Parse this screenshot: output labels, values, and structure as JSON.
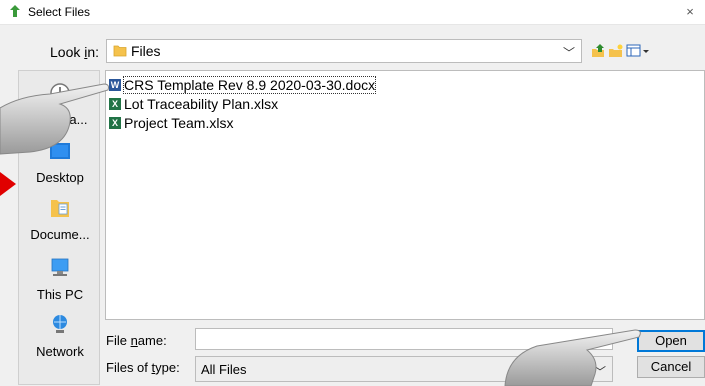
{
  "window": {
    "title": "Select Files",
    "close_glyph": "×"
  },
  "lookin": {
    "label_pre": "Look ",
    "label_u": "i",
    "label_post": "n:",
    "value": "Files"
  },
  "toolbar": [
    {
      "name": "up-one-level-icon",
      "glyph": "⬆"
    },
    {
      "name": "new-folder-icon",
      "glyph": "✦"
    },
    {
      "name": "view-menu-icon",
      "glyph": "▦▾"
    }
  ],
  "places": [
    {
      "name": "place-recent",
      "label": "Quick a..."
    },
    {
      "name": "place-desktop",
      "label": "Desktop"
    },
    {
      "name": "place-documents",
      "label": "Docume..."
    },
    {
      "name": "place-this-pc",
      "label": "This PC"
    },
    {
      "name": "place-network",
      "label": "Network"
    }
  ],
  "files": [
    {
      "name": "CRS Template Rev 8.9 2020-03-30.docx",
      "type": "docx",
      "icon_color": "#2b579a",
      "icon_letter": "W"
    },
    {
      "name": "Lot Traceability Plan.xlsx",
      "type": "xlsx",
      "icon_color": "#217346",
      "icon_letter": "X"
    },
    {
      "name": "Project Team.xlsx",
      "type": "xlsx",
      "icon_color": "#217346",
      "icon_letter": "X"
    }
  ],
  "filename": {
    "label_pre": "File ",
    "label_u": "n",
    "label_post": "ame:",
    "value": ""
  },
  "filetype": {
    "label_pre": "Files of ",
    "label_u": "t",
    "label_post": "ype:",
    "value": "All Files"
  },
  "buttons": {
    "open": "Open",
    "cancel": "Cancel"
  },
  "colors": {
    "accent": "#0078d7",
    "arrow": "#e00000"
  }
}
